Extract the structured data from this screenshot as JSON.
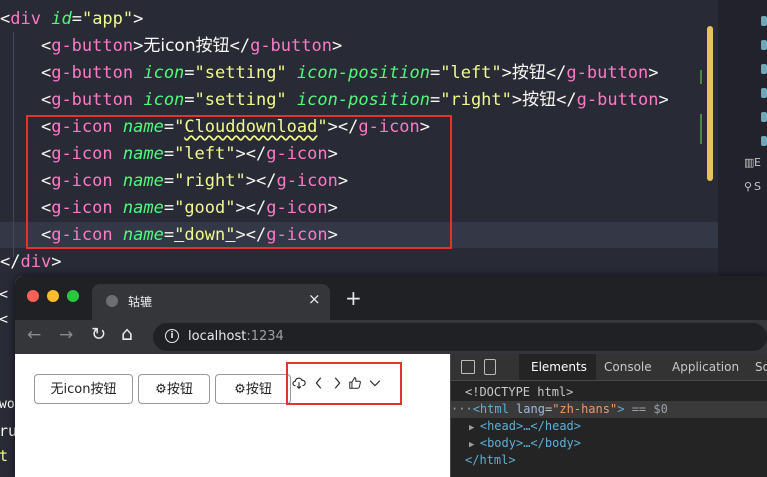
{
  "editor": {
    "lines": [
      {
        "indent": "",
        "open": "<",
        "tag": "div",
        "attr": "id",
        "eq": "=",
        "val": "\"app\"",
        "close": ">"
      },
      {
        "indent": "    ",
        "open": "<",
        "tag": "g-button",
        "close": ">",
        "text": "无icon按钮",
        "end_open": "</",
        "end_tag": "g-button",
        "end_close": ">"
      },
      {
        "indent": "    ",
        "open": "<",
        "tag": "g-button",
        "attr1": "icon",
        "val1": "\"setting\"",
        "attr2": "icon-position",
        "val2": "\"left\"",
        "close": ">",
        "text": "按钮",
        "end_open": "</",
        "end_tag": "g-button",
        "end_close": ">"
      },
      {
        "indent": "    ",
        "open": "<",
        "tag": "g-button",
        "attr1": "icon",
        "val1": "\"setting\"",
        "attr2": "icon-position",
        "val2": "\"right\"",
        "close": ">",
        "text": "按钮",
        "end_open": "</",
        "end_tag": "g-button",
        "end_close": ">"
      },
      {
        "indent": "    ",
        "open": "<",
        "tag": "g-icon",
        "attr": "name",
        "eq": "=",
        "q1": "\"",
        "val": "Clouddownload",
        "q2": "\"",
        "close": "></",
        "end_tag": "g-icon",
        "end_close": ">"
      },
      {
        "indent": "    ",
        "open": "<",
        "tag": "g-icon",
        "attr": "name",
        "eq": "=",
        "val": "\"left\"",
        "close": "></",
        "end_tag": "g-icon",
        "end_close": ">"
      },
      {
        "indent": "    ",
        "open": "<",
        "tag": "g-icon",
        "attr": "name",
        "eq": "=",
        "val": "\"right\"",
        "close": "></",
        "end_tag": "g-icon",
        "end_close": ">"
      },
      {
        "indent": "    ",
        "open": "<",
        "tag": "g-icon",
        "attr": "name",
        "eq": "=",
        "val": "\"good\"",
        "close": "></",
        "end_tag": "g-icon",
        "end_close": ">"
      },
      {
        "indent": "    ",
        "open": "<",
        "tag": "g-icon",
        "attr": "name",
        "eq": "=",
        "q1": "\"",
        "val": "down",
        "q2": "\"",
        "close": "></",
        "end_tag": "g-icon",
        "end_close": ">"
      },
      {
        "indent": "",
        "open": "</",
        "tag": "div",
        "close": ">"
      }
    ],
    "accent_box_color": "#e0342c"
  },
  "side_panel": {
    "texts": [
      "E",
      "S"
    ]
  },
  "terminal": {
    "fragments": [
      "<",
      "<",
      "wo",
      "ru",
      "t"
    ]
  },
  "browser": {
    "tab_title": "轱辘",
    "tab_close": "×",
    "new_tab": "+",
    "back": "←",
    "forward": "→",
    "reload": "↻",
    "home": "⌂",
    "info": "i",
    "url_host": "localhost",
    "url_port": ":1234",
    "page": {
      "buttons": [
        {
          "label": "无icon按钮"
        },
        {
          "label": "⚙按钮"
        },
        {
          "label": "⚙按钮"
        }
      ],
      "icons": [
        "cloud-download-icon",
        "chevron-left-icon",
        "chevron-right-icon",
        "thumbs-up-icon",
        "chevron-down-icon"
      ]
    },
    "devtools": {
      "tabs": [
        "Elements",
        "Console",
        "Application",
        "So"
      ],
      "active_tab": "Elements",
      "dom": {
        "doctype": "<!DOCTYPE html>",
        "html_open": "<html",
        "lang_attr": "lang",
        "lang_val": "\"zh-hans\"",
        "html_close_bracket": ">",
        "selected_marker": "== $0",
        "head": "<head>…</head>",
        "body": "<body>…</body>",
        "html_end": "</html>"
      }
    }
  }
}
